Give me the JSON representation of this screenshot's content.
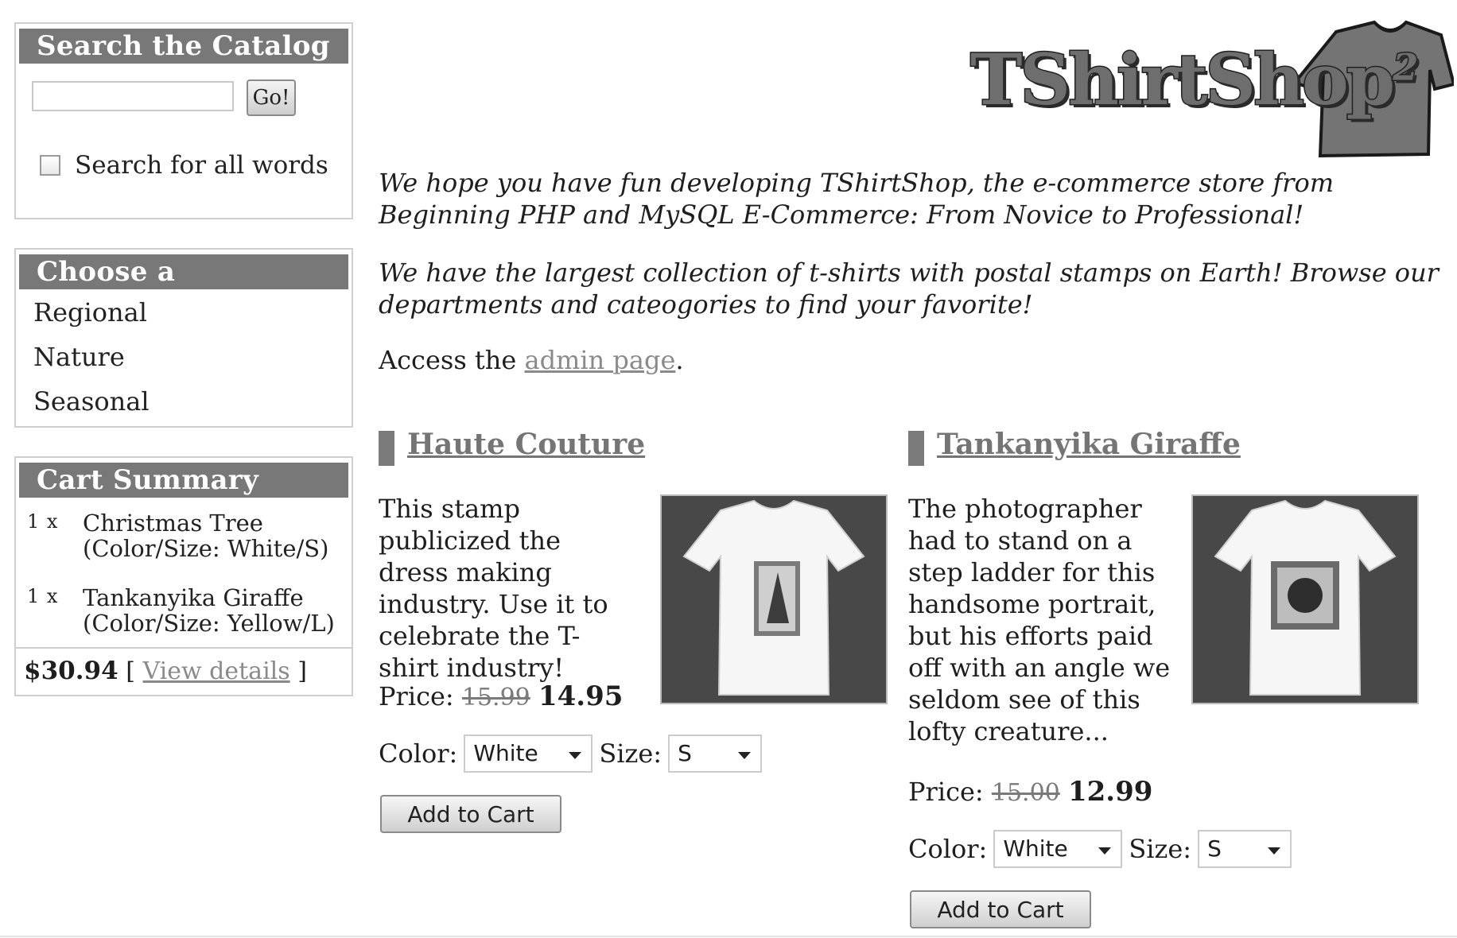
{
  "search": {
    "title": "Search the Catalog",
    "input_value": "",
    "go_label": "Go!",
    "all_words_label": "Search for all words",
    "all_words_checked": false
  },
  "departments": {
    "title": "Choose a Department",
    "items": [
      {
        "label": "Regional"
      },
      {
        "label": "Nature"
      },
      {
        "label": "Seasonal"
      }
    ]
  },
  "cart": {
    "title": "Cart Summary",
    "items": [
      {
        "qty": "1 x",
        "name": "Christmas Tree",
        "detail": "(Color/Size: White/S)"
      },
      {
        "qty": "1 x",
        "name": "Tankanyika Giraffe",
        "detail": "(Color/Size: Yellow/L)"
      }
    ],
    "total": "$30.94",
    "open_bracket": "[",
    "view_details_label": "View details",
    "close_bracket": "]"
  },
  "logo": {
    "text": "TShirtShop",
    "superscript": "2"
  },
  "intro": {
    "p1": "We hope you have fun developing TShirtShop, the e-commerce store from Beginning PHP and MySQL E-Commerce: From Novice to Professional!",
    "p2": "We have the largest collection of t-shirts with postal stamps on Earth! Browse our departments and cateogories to find your favorite!",
    "access_prefix": "Access the",
    "admin_link": "admin page",
    "access_suffix": "."
  },
  "products": [
    {
      "name": "Haute Couture",
      "description": "This stamp publicized the dress making industry. Use it to celebrate the T-shirt industry!",
      "price_label": "Price:",
      "old_price": "15.99",
      "new_price": "14.95",
      "color_label": "Color:",
      "color_value": "White",
      "size_label": "Size:",
      "size_value": "S",
      "add_to_cart": "Add to Cart"
    },
    {
      "name": "Tankanyika Giraffe",
      "description": "The photographer had to stand on a step ladder for this handsome portrait, but his efforts paid off with an angle we seldom see of this lofty creature...",
      "price_label": "Price:",
      "old_price": "15.00",
      "new_price": "12.99",
      "color_label": "Color:",
      "color_value": "White",
      "size_label": "Size:",
      "size_value": "S",
      "add_to_cart": "Add to Cart"
    }
  ],
  "colors": {
    "header_bar": "#787878",
    "link": "#8a8a8a",
    "product_bg": "#484848"
  }
}
